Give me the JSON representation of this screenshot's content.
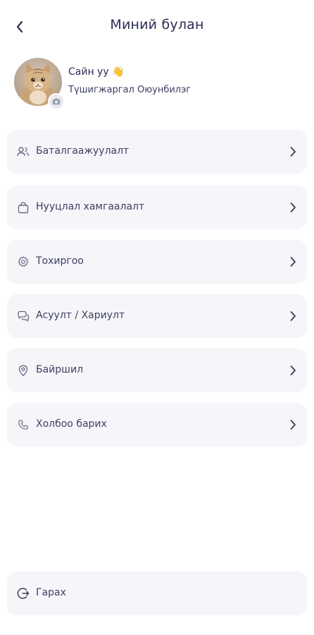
{
  "header": {
    "title": "Миний булан",
    "back_icon": "chevron-left-icon"
  },
  "profile": {
    "greeting": "Сайн уу",
    "greeting_emoji": "👋",
    "name": "Түшигжаргал Оюунбилэг",
    "avatar_icon": "cat-avatar",
    "camera_icon": "camera-icon"
  },
  "menu": [
    {
      "label": "Баталгаажуулалт",
      "icon": "users-icon"
    },
    {
      "label": "Нууцлал хамгаалалт",
      "icon": "shopping-bag-icon"
    },
    {
      "label": "Тохиргоо",
      "icon": "gear-icon"
    },
    {
      "label": "Асуулт / Хариулт",
      "icon": "chat-bubbles-icon"
    },
    {
      "label": "Байршил",
      "icon": "location-pin-icon"
    },
    {
      "label": "Холбоо барих",
      "icon": "phone-icon"
    }
  ],
  "logout": {
    "label": "Гарах",
    "icon": "logout-icon"
  },
  "colors": {
    "text_primary": "#2b2d55",
    "card_background": "#f5f5fa",
    "icon_gray": "#6a6c82"
  }
}
